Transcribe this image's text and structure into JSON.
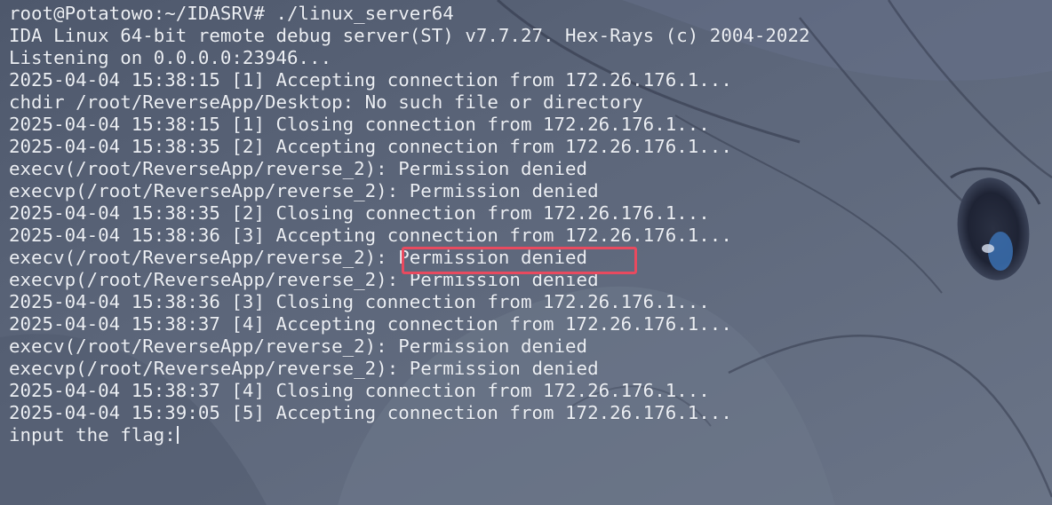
{
  "terminal": {
    "lines": [
      "root@Potatowo:~/IDASRV# ./linux_server64",
      "IDA Linux 64-bit remote debug server(ST) v7.7.27. Hex-Rays (c) 2004-2022",
      "Listening on 0.0.0.0:23946...",
      "2025-04-04 15:38:15 [1] Accepting connection from 172.26.176.1...",
      "chdir /root/ReverseApp/Desktop: No such file or directory",
      "2025-04-04 15:38:15 [1] Closing connection from 172.26.176.1...",
      "2025-04-04 15:38:35 [2] Accepting connection from 172.26.176.1...",
      "execv(/root/ReverseApp/reverse_2): Permission denied",
      "execvp(/root/ReverseApp/reverse_2): Permission denied",
      "2025-04-04 15:38:35 [2] Closing connection from 172.26.176.1...",
      "2025-04-04 15:38:36 [3] Accepting connection from 172.26.176.1...",
      "execv(/root/ReverseApp/reverse_2): Permission denied",
      "execvp(/root/ReverseApp/reverse_2): Permission denied",
      "2025-04-04 15:38:36 [3] Closing connection from 172.26.176.1...",
      "2025-04-04 15:38:37 [4] Accepting connection from 172.26.176.1...",
      "execv(/root/ReverseApp/reverse_2): Permission denied",
      "execvp(/root/ReverseApp/reverse_2): Permission denied",
      "2025-04-04 15:38:37 [4] Closing connection from 172.26.176.1...",
      "2025-04-04 15:39:05 [5] Accepting connection from 172.26.176.1...",
      "input the flag:"
    ]
  },
  "colors": {
    "text": "#eceff4",
    "background": "#5a6478",
    "highlight": "#e84a5f"
  }
}
